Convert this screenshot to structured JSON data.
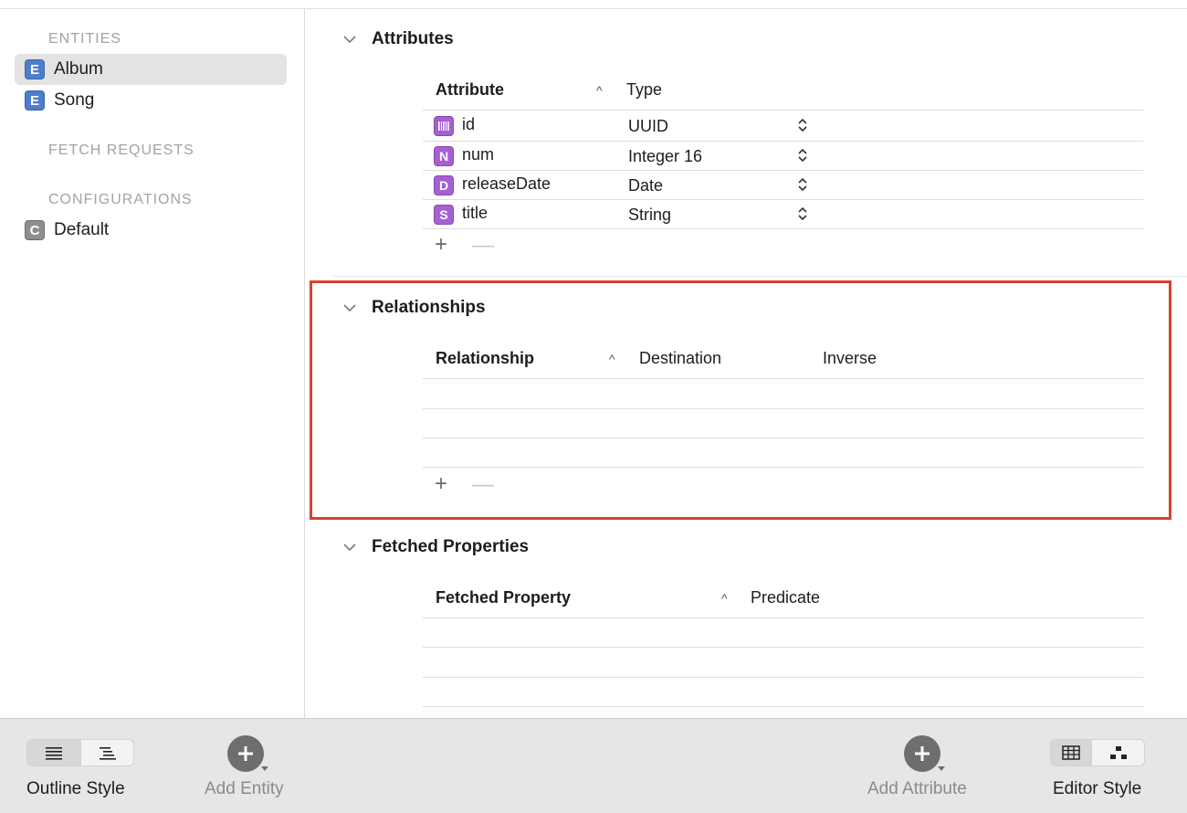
{
  "sidebar": {
    "entities_header": "ENTITIES",
    "entities": [
      {
        "icon_letter": "E",
        "label": "Album",
        "selected": true
      },
      {
        "icon_letter": "E",
        "label": "Song",
        "selected": false
      }
    ],
    "fetch_requests_header": "FETCH REQUESTS",
    "configurations_header": "CONFIGURATIONS",
    "configurations": [
      {
        "icon_letter": "C",
        "label": "Default"
      }
    ]
  },
  "attributes": {
    "title": "Attributes",
    "col_attribute": "Attribute",
    "col_type": "Type",
    "sort_caret": "^",
    "rows": [
      {
        "icon_letter": "",
        "icon": "uuid-barcode-icon",
        "name": "id",
        "type": "UUID"
      },
      {
        "icon_letter": "N",
        "icon": "number-icon",
        "name": "num",
        "type": "Integer 16"
      },
      {
        "icon_letter": "D",
        "icon": "date-icon",
        "name": "releaseDate",
        "type": "Date"
      },
      {
        "icon_letter": "S",
        "icon": "string-icon",
        "name": "title",
        "type": "String"
      }
    ],
    "add": "+",
    "remove": "—"
  },
  "relationships": {
    "title": "Relationships",
    "col_relationship": "Relationship",
    "col_destination": "Destination",
    "col_inverse": "Inverse",
    "sort_caret": "^",
    "add": "+",
    "remove": "—"
  },
  "fetched": {
    "title": "Fetched Properties",
    "col_property": "Fetched Property",
    "col_predicate": "Predicate",
    "sort_caret": "^"
  },
  "toolbar": {
    "outline_style": "Outline Style",
    "add_entity": "Add Entity",
    "add_attribute": "Add Attribute",
    "editor_style": "Editor Style"
  },
  "colors": {
    "highlight": "#d6432f",
    "entity_icon": "#4d7ec9",
    "attribute_icon": "#a560d3"
  }
}
